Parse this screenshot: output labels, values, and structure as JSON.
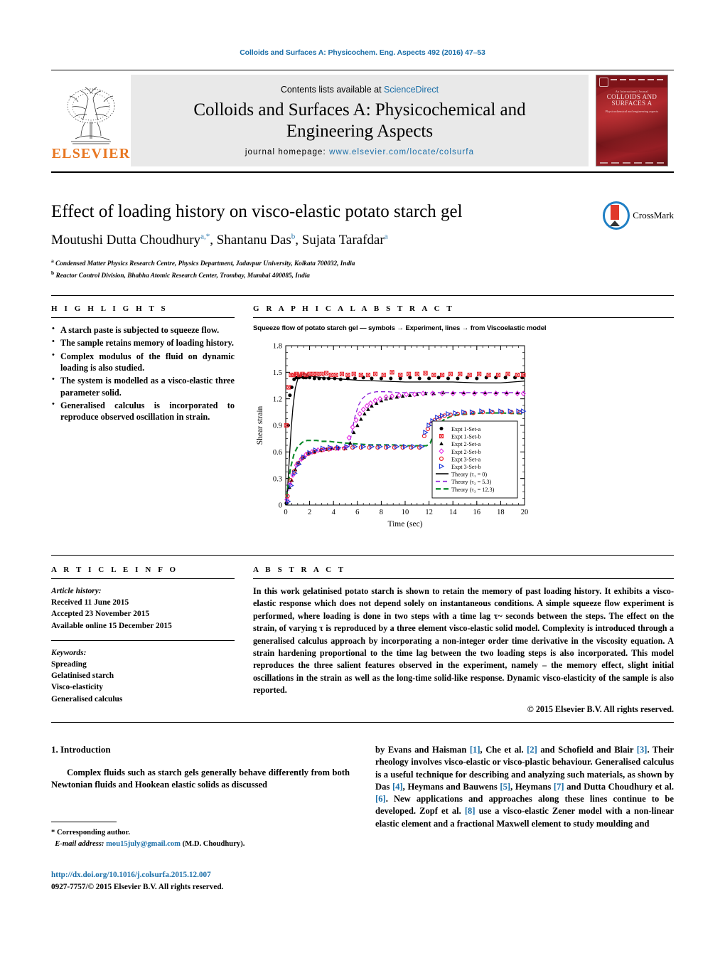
{
  "running_head": "Colloids and Surfaces A: Physicochem. Eng. Aspects 492 (2016) 47–53",
  "masthead": {
    "contents_prefix": "Contents lists available at ",
    "sciencedirect": "ScienceDirect",
    "journal_line1": "Colloids and Surfaces A: Physicochemical and",
    "journal_line2": "Engineering Aspects",
    "homepage_label": "journal homepage: ",
    "homepage_url": "www.elsevier.com/locate/colsurfa",
    "publisher": "ELSEVIER",
    "cover": {
      "small_top": "An International Journal",
      "title": "COLLOIDS AND SURFACES A",
      "subtitle": "Physicochemical and engineering aspects"
    }
  },
  "article": {
    "title": "Effect of loading history on visco-elastic potato starch gel",
    "authors": [
      {
        "name": "Moutushi Dutta Choudhury",
        "marks": "a,*"
      },
      {
        "name": "Shantanu Das",
        "marks": "b"
      },
      {
        "name": "Sujata Tarafdar",
        "marks": "a"
      }
    ],
    "affiliations": [
      {
        "mark": "a",
        "text": "Condensed Matter Physics Research Centre, Physics Department, Jadavpur University, Kolkata 700032, India"
      },
      {
        "mark": "b",
        "text": "Reactor Control Division, Bhabha Atomic Research Center, Trombay, Mumbai 400085, India"
      }
    ],
    "crossmark_label": "CrossMark"
  },
  "highlights": {
    "heading": "H I G H L I G H T S",
    "items": [
      "A starch paste is subjected to squeeze flow.",
      "The sample retains memory of loading history.",
      "Complex modulus of the fluid on dynamic loading is also studied.",
      "The system is modelled as a visco-elastic three parameter solid.",
      "Generalised calculus is incorporated to reproduce observed oscillation in strain."
    ]
  },
  "graphical_abstract": {
    "heading": "G R A P H I C A L   A B S T R A C T",
    "caption": "Squeeze flow of potato starch gel — symbols → Experiment,  lines →  from Viscoelastic model"
  },
  "chart_data": {
    "type": "scatter",
    "title": "Squeeze flow of potato starch gel — symbols → Experiment,  lines →  from Viscoelastic model",
    "xlabel": "Time (sec)",
    "ylabel": "Shear strain",
    "xlim": [
      0,
      20
    ],
    "ylim": [
      0,
      1.8
    ],
    "xticks": [
      0,
      2,
      4,
      6,
      8,
      10,
      12,
      14,
      16,
      18,
      20
    ],
    "yticks": [
      0,
      0.3,
      0.6,
      0.9,
      1.2,
      1.5,
      1.8
    ],
    "xminor_per_interval": 4,
    "grid": false,
    "legend_position": "lower-right-inside",
    "series": [
      {
        "name": "Expt 1-Set-a",
        "marker": "filled-circle",
        "color": "#000000",
        "x": [
          0.05,
          0.2,
          0.35,
          0.5,
          0.7,
          0.9,
          1.1,
          1.3,
          1.5,
          1.7,
          2.0,
          2.4,
          2.8,
          3.2,
          3.6,
          4.1,
          4.6,
          5.2,
          5.8,
          6.5,
          7.2,
          8.0,
          8.8,
          9.6,
          10.4,
          11.2,
          12.0,
          12.8,
          13.6,
          14.4,
          15.2,
          16.0,
          16.8,
          17.6,
          18.4,
          19.2,
          19.8
        ],
        "y": [
          0.02,
          0.9,
          1.24,
          1.33,
          1.42,
          1.44,
          1.44,
          1.45,
          1.44,
          1.44,
          1.44,
          1.43,
          1.43,
          1.43,
          1.43,
          1.43,
          1.42,
          1.43,
          1.43,
          1.44,
          1.43,
          1.43,
          1.43,
          1.43,
          1.44,
          1.43,
          1.43,
          1.44,
          1.43,
          1.43,
          1.44,
          1.43,
          1.44,
          1.44,
          1.44,
          1.44,
          1.44
        ]
      },
      {
        "name": "Expt 1-Set-b",
        "marker": "crossed-square",
        "color": "#e8212a",
        "x": [
          0.05,
          0.25,
          0.45,
          0.65,
          0.9,
          1.15,
          1.4,
          1.7,
          2.0,
          2.3,
          2.6,
          3.0,
          3.4,
          3.8,
          4.2,
          4.7,
          5.2,
          5.7,
          6.3,
          6.9,
          7.5,
          8.2,
          8.9,
          9.6,
          10.3,
          11.0,
          11.7,
          12.4,
          13.1,
          13.8,
          14.6,
          15.4,
          16.2,
          17.0,
          17.8,
          18.6,
          19.4,
          19.9
        ],
        "y": [
          0.9,
          1.33,
          1.47,
          1.47,
          1.48,
          1.47,
          1.48,
          1.47,
          1.48,
          1.48,
          1.48,
          1.48,
          1.49,
          1.47,
          1.47,
          1.48,
          1.47,
          1.48,
          1.47,
          1.47,
          1.48,
          1.47,
          1.5,
          1.47,
          1.48,
          1.48,
          1.49,
          1.47,
          1.47,
          1.48,
          1.48,
          1.47,
          1.48,
          1.47,
          1.47,
          1.48,
          1.47,
          1.47
        ]
      },
      {
        "name": "Expt 2-Set-a",
        "marker": "filled-triangle",
        "color": "#000000",
        "x": [
          0.1,
          0.3,
          0.5,
          0.8,
          1.1,
          1.5,
          1.9,
          2.4,
          2.9,
          3.4,
          3.9,
          4.4,
          5.0,
          5.4,
          5.7,
          6.0,
          6.3,
          6.6,
          6.9,
          7.2,
          7.6,
          8.0,
          8.4,
          8.8,
          9.3,
          9.8,
          10.4,
          11.0,
          11.7,
          12.4,
          13.2,
          14.0,
          14.9,
          15.8,
          16.7,
          17.6,
          18.5,
          19.4
        ],
        "y": [
          0.03,
          0.2,
          0.28,
          0.4,
          0.48,
          0.54,
          0.58,
          0.6,
          0.62,
          0.63,
          0.64,
          0.64,
          0.64,
          0.7,
          0.82,
          0.9,
          0.97,
          1.03,
          1.08,
          1.12,
          1.15,
          1.18,
          1.2,
          1.21,
          1.22,
          1.23,
          1.24,
          1.25,
          1.26,
          1.26,
          1.27,
          1.27,
          1.27,
          1.27,
          1.27,
          1.27,
          1.27,
          1.27
        ]
      },
      {
        "name": "Expt 2-Set-b",
        "marker": "open-diamond",
        "color": "#e52ee5",
        "x": [
          0.1,
          0.35,
          0.6,
          0.9,
          1.3,
          1.7,
          2.2,
          2.7,
          3.2,
          3.8,
          4.4,
          5.0,
          5.3,
          5.6,
          5.9,
          6.2,
          6.5,
          6.8,
          7.1,
          7.5,
          7.9,
          8.4,
          8.9,
          9.5,
          10.1,
          10.8,
          11.5,
          12.3,
          13.1,
          14.0,
          14.9,
          15.8,
          16.7,
          17.6,
          18.5,
          19.4,
          19.9
        ],
        "y": [
          0.06,
          0.24,
          0.34,
          0.45,
          0.52,
          0.57,
          0.6,
          0.62,
          0.63,
          0.64,
          0.64,
          0.65,
          0.76,
          0.88,
          0.96,
          1.03,
          1.08,
          1.12,
          1.15,
          1.18,
          1.2,
          1.22,
          1.23,
          1.24,
          1.25,
          1.25,
          1.26,
          1.26,
          1.26,
          1.26,
          1.26,
          1.26,
          1.26,
          1.26,
          1.26,
          1.26,
          1.26
        ]
      },
      {
        "name": "Expt 3-Set-a",
        "marker": "open-circle",
        "color": "#e8212a",
        "x": [
          0.15,
          0.4,
          0.7,
          1.0,
          1.4,
          1.9,
          2.4,
          3.0,
          3.6,
          4.2,
          4.9,
          5.6,
          6.3,
          7.0,
          7.7,
          8.4,
          9.1,
          9.8,
          10.5,
          11.2,
          11.6,
          11.9,
          12.2,
          12.5,
          12.9,
          13.3,
          13.8,
          14.4,
          15.0,
          15.7,
          16.5,
          17.3,
          18.1,
          18.9,
          19.6
        ],
        "y": [
          0.1,
          0.28,
          0.38,
          0.47,
          0.53,
          0.58,
          0.6,
          0.62,
          0.63,
          0.64,
          0.64,
          0.65,
          0.65,
          0.65,
          0.65,
          0.65,
          0.65,
          0.65,
          0.65,
          0.65,
          0.78,
          0.86,
          0.92,
          0.96,
          0.99,
          1.01,
          1.02,
          1.03,
          1.04,
          1.04,
          1.05,
          1.05,
          1.05,
          1.05,
          1.05
        ]
      },
      {
        "name": "Expt 3-Set-b",
        "marker": "open-right-triangle",
        "color": "#1a34d8",
        "x": [
          0.2,
          0.45,
          0.75,
          1.1,
          1.5,
          2.0,
          2.5,
          3.1,
          3.7,
          4.4,
          5.1,
          5.8,
          6.5,
          7.2,
          7.9,
          8.6,
          9.3,
          10.0,
          10.7,
          11.4,
          11.7,
          12.0,
          12.3,
          12.7,
          13.1,
          13.6,
          14.2,
          14.9,
          15.6,
          16.4,
          17.2,
          18.0,
          18.8,
          19.5,
          19.9
        ],
        "y": [
          0.04,
          0.22,
          0.36,
          0.46,
          0.54,
          0.59,
          0.62,
          0.64,
          0.65,
          0.65,
          0.66,
          0.66,
          0.66,
          0.66,
          0.66,
          0.66,
          0.66,
          0.66,
          0.66,
          0.66,
          0.82,
          0.9,
          0.95,
          0.99,
          1.01,
          1.03,
          1.04,
          1.05,
          1.05,
          1.06,
          1.06,
          1.06,
          1.06,
          1.06,
          1.06
        ]
      }
    ],
    "lines": [
      {
        "name": "Theory (τ₁ = 0)",
        "style": "solid",
        "color": "#000000",
        "x": [
          0,
          0.15,
          0.3,
          0.45,
          0.6,
          0.8,
          1.0,
          1.2,
          1.4,
          1.6,
          1.8,
          2.0,
          2.4,
          3.0,
          4.0,
          5.0,
          6.0,
          8.0,
          10.0,
          12.0,
          14.0,
          16.0,
          18.0,
          20.0
        ],
        "y": [
          0.0,
          0.18,
          0.52,
          0.85,
          1.1,
          1.32,
          1.42,
          1.46,
          1.48,
          1.48,
          1.47,
          1.46,
          1.45,
          1.44,
          1.43,
          1.42,
          1.41,
          1.4,
          1.39,
          1.39,
          1.39,
          1.38,
          1.38,
          1.4
        ]
      },
      {
        "name": "Theory (τ₂ = 5.3)",
        "style": "dashed",
        "color": "#8b1fd8",
        "x": [
          0,
          0.3,
          0.6,
          1.0,
          1.5,
          2.0,
          2.6,
          3.2,
          3.8,
          4.4,
          5.0,
          5.3,
          5.5,
          5.8,
          6.1,
          6.4,
          6.8,
          7.2,
          7.6,
          8.0,
          8.6,
          9.4,
          10.5,
          12.0,
          14.0,
          16.0,
          18.0,
          20.0
        ],
        "y": [
          0.0,
          0.2,
          0.35,
          0.47,
          0.55,
          0.59,
          0.62,
          0.63,
          0.64,
          0.65,
          0.65,
          0.66,
          0.8,
          1.0,
          1.13,
          1.2,
          1.25,
          1.27,
          1.28,
          1.28,
          1.28,
          1.27,
          1.27,
          1.27,
          1.27,
          1.27,
          1.27,
          1.27
        ]
      },
      {
        "name": "Theory (τ₃ = 12.3)",
        "style": "dash-thick",
        "color": "#0a8a2a",
        "x": [
          0,
          0.2,
          0.4,
          0.7,
          1.0,
          1.4,
          1.8,
          2.2,
          2.6,
          3.0,
          3.6,
          4.2,
          5.0,
          6.0,
          7.0,
          8.0,
          9.0,
          10.0,
          11.0,
          11.8,
          12.1,
          12.4,
          12.8,
          13.2,
          13.8,
          14.5,
          15.5,
          16.5,
          18.0,
          20.0
        ],
        "y": [
          0.0,
          0.22,
          0.42,
          0.58,
          0.66,
          0.71,
          0.73,
          0.73,
          0.73,
          0.72,
          0.72,
          0.71,
          0.7,
          0.69,
          0.68,
          0.68,
          0.68,
          0.67,
          0.67,
          0.67,
          0.7,
          0.8,
          0.9,
          0.96,
          1.0,
          1.02,
          1.03,
          1.04,
          1.04,
          1.03
        ]
      }
    ]
  },
  "article_info": {
    "heading": "A R T I C L E   I N F O",
    "history_label": "Article history:",
    "received": "Received 11 June 2015",
    "accepted": "Accepted 23 November 2015",
    "available": "Available online 15 December 2015",
    "keywords_label": "Keywords:",
    "keywords": [
      "Spreading",
      "Gelatinised starch",
      "Visco-elasticity",
      "Generalised calculus"
    ]
  },
  "abstract": {
    "heading": "A B S T R A C T",
    "text": "In this work gelatinised potato starch is shown to retain the memory of past loading history. It exhibits a visco-elastic response which does not depend solely on instantaneous conditions. A simple squeeze flow experiment is performed, where loading is done in two steps with a time lag τ~ seconds between the steps. The effect on the strain, of varying τ is reproduced by a three element visco-elastic solid model. Complexity is introduced through a generalised calculus approach by incorporating a non-integer order time derivative in the viscosity equation. A strain hardening proportional to the time lag between the two loading steps is also incorporated. This model reproduces the three salient features observed in the experiment, namely – the memory effect, slight initial oscillations in the strain as well as the long-time solid-like response. Dynamic visco-elasticity of the sample is also reported.",
    "copyright": "© 2015 Elsevier B.V. All rights reserved."
  },
  "body": {
    "section_number_title": "1.  Introduction",
    "left_paragraph": "Complex fluids such as starch gels generally behave differently from both Newtonian fluids and Hookean elastic solids as discussed",
    "right_paragraph_parts": [
      {
        "t": "by Evans and Haisman "
      },
      {
        "t": "[1]",
        "ref": true
      },
      {
        "t": ", Che et al. "
      },
      {
        "t": "[2]",
        "ref": true
      },
      {
        "t": " and Schofield and Blair "
      },
      {
        "t": "[3]",
        "ref": true
      },
      {
        "t": ". Their rheology involves visco-elastic or visco-plastic behaviour. Generalised calculus is a useful technique for describing and analyzing such materials, as shown by Das "
      },
      {
        "t": "[4]",
        "ref": true
      },
      {
        "t": ", Heymans and Bauwens "
      },
      {
        "t": "[5]",
        "ref": true
      },
      {
        "t": ", Heymans "
      },
      {
        "t": "[7]",
        "ref": true
      },
      {
        "t": " and Dutta Choudhury et al. "
      },
      {
        "t": "[6]",
        "ref": true
      },
      {
        "t": ". New applications and approaches along these lines continue to be developed. Zopf et al. "
      },
      {
        "t": "[8]",
        "ref": true
      },
      {
        "t": " use a visco-elastic Zener model with a non-linear elastic element and a fractional Maxwell element to study moulding and"
      }
    ]
  },
  "footer": {
    "corresponding": "* Corresponding author.",
    "email_label": "E-mail address:",
    "email": "mou15july@gmail.com",
    "email_suffix": "(M.D. Choudhury).",
    "doi": "http://dx.doi.org/10.1016/j.colsurfa.2015.12.007",
    "issn_line": "0927-7757/© 2015 Elsevier B.V. All rights reserved."
  },
  "colors": {
    "link": "#1a6ea8",
    "elsevier_orange": "#E87722",
    "cover_red": "#9d2026"
  }
}
